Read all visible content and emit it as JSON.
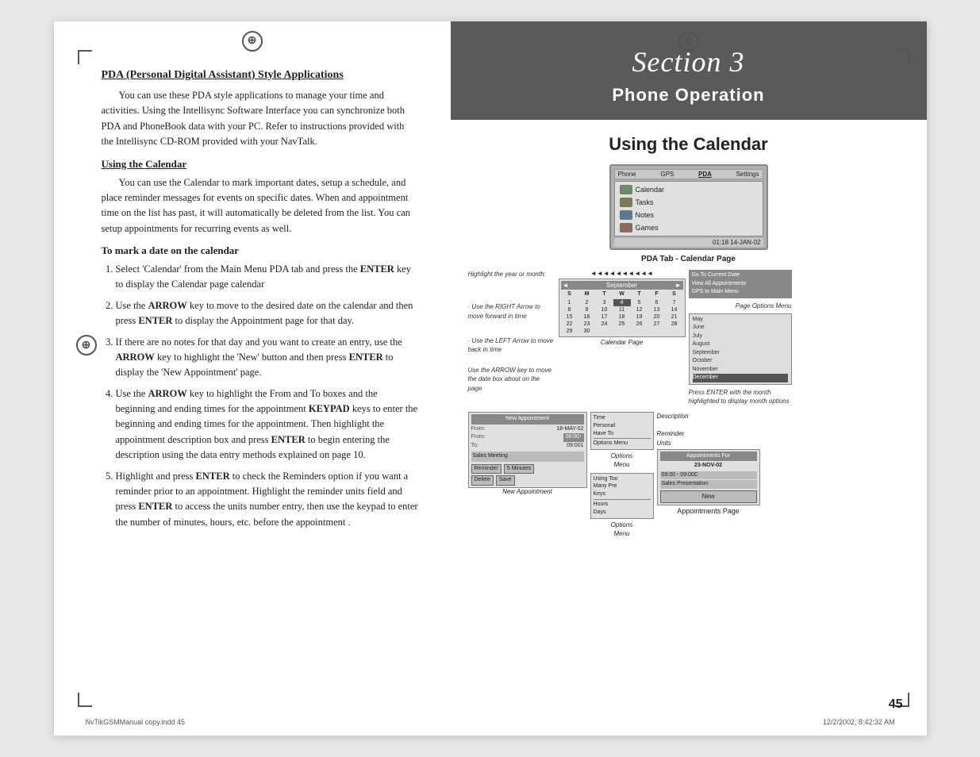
{
  "page": {
    "background": "#e8e8e8",
    "page_number": "45"
  },
  "section_header": {
    "label": "Section 3",
    "title": "Phone Operation"
  },
  "right_col": {
    "using_calendar_title": "Using the Calendar",
    "pda_tab_label": "PDA Tab - Calendar Page",
    "device": {
      "top_tabs": [
        "Phone",
        "GPS",
        "PDA",
        "Settings"
      ],
      "menu_items": [
        "Calendar",
        "Tasks",
        "Notes",
        "Games"
      ],
      "status": "01:18  14-JAN-02"
    },
    "calendar_diagram": {
      "left_note_1": "Highlight the year or month:",
      "left_note_bullet1": "Use the RIGHT Arrow to move forward in time",
      "left_note_bullet2": "Use the LEFT Arrow to move back in time",
      "left_note_3": "Use the ARROW key to move the date box about on the page",
      "calendar_month": "September",
      "calendar_days_header": [
        "S",
        "M",
        "T",
        "W",
        "T",
        "F",
        "S"
      ],
      "calendar_rows": [
        [
          "",
          "",
          "",
          "",
          "",
          "",
          ""
        ],
        [
          "1",
          "2",
          "3",
          "4",
          "5",
          "6",
          "7"
        ],
        [
          "8",
          "9",
          "10",
          "11",
          "12",
          "13",
          "14"
        ],
        [
          "15",
          "16",
          "17",
          "18",
          "19",
          "20",
          "21"
        ],
        [
          "22",
          "23",
          "24",
          "25",
          "26",
          "27",
          "28"
        ],
        [
          "29",
          "30",
          "",
          "",
          "",
          "",
          ""
        ]
      ],
      "calendar_label": "Calendar Page",
      "right_page_options": "Go To Current Date\nView All Appointments\nGPS to Main Menu",
      "page_options_menu_label": "Page Options Menu",
      "month_list": [
        "May",
        "June",
        "July",
        "August",
        "September",
        "October",
        "November",
        "December"
      ],
      "selected_month": "December",
      "month_note": "Press ENTER with the month highlighted to display month options"
    },
    "appointment_diagram": {
      "new_appt_header": "New Appointment",
      "form_fields": [
        {
          "label": "From:",
          "value": "08-002"
        },
        {
          "label": "To:",
          "value": "09-001"
        },
        {
          "label": "",
          "value": "Sales Meeting"
        }
      ],
      "options_menu_items": [
        "Time",
        "Personal",
        "Have To",
        "Options Menu",
        "Description",
        "Reminder Units"
      ],
      "options_label": "Options\nMenu",
      "reminder_label": "Reminder\nUnits",
      "reminder_btn": "Reminder",
      "minutes_btn": "5 Minutes",
      "units_options": [
        "Using Too\nMany Pre\nKeys",
        "\nHours\nDays"
      ],
      "units_menu_label": "Options\nMenu",
      "appt_for_header": "Appointments For",
      "appt_for_date": "23-NOV-02",
      "appt_entries": [
        "09:00 - 09:00C",
        "Sales Presentation"
      ],
      "new_button": "New",
      "new_appt_label": "New Appointment",
      "appt_page_label": "Appointments Page"
    }
  },
  "left_col": {
    "heading": "PDA (Personal Digital Assistant) Style Applications",
    "intro_text": "You can use these PDA style applications to manage your time and activities. Using the Intellisync Software Interface you can synchronize both PDA and PhoneBook data with your PC. Refer to instructions provided with the Intellisync CD-ROM provided with your NavTalk.",
    "sub_heading": "Using the Calendar",
    "calendar_text": "You can use the Calendar to mark important dates, setup a schedule, and place reminder messages for events on specific dates. When and appointment time on the list has past, it will automatically be deleted from the list. You can setup appointments for recurring events as well.",
    "mark_date_heading": "To mark a date on the calendar",
    "steps": [
      "Select 'Calendar' from the Main Menu PDA tab and press the ENTER key to display the Calendar page calendar",
      "Use the ARROW key to move to the desired date on the calendar and then press ENTER to display the Appointment page for that day.",
      "If there are no notes for that day and you want to create an entry, use the ARROW key to highlight the 'New' button and then press ENTER to display the 'New Appointment'  page.",
      "Use the ARROW key to highlight the From and To boxes and the beginning and ending times for the appointment KEYPAD keys to enter the beginning and ending times for the appointment. Then highlight the appointment description box and press ENTER to begin entering the description using the data entry methods explained on page 10.",
      "Highlight and press ENTER to check the Reminders option if you want a reminder prior to an appointment.  Highlight the reminder units field and press ENTER to access the units number entry, then use the keypad to enter the number of minutes, hours, etc. before the appointment ."
    ],
    "step_keywords": {
      "1_bold": "ENTER",
      "2_bold1": "ARROW",
      "2_bold2": "ENTER",
      "3_bold1": "ARROW",
      "3_bold2": "ENTER",
      "4_bold1": "ARROW",
      "4_bold2": "KEYPAD",
      "4_bold3": "ENTER",
      "5_bold1": "ENTER",
      "5_bold2": "ENTER"
    }
  },
  "bottom_info": {
    "left": "NvTikGSMManual copy.indd   45",
    "right": "12/2/2002, 8:42:32 AM"
  }
}
